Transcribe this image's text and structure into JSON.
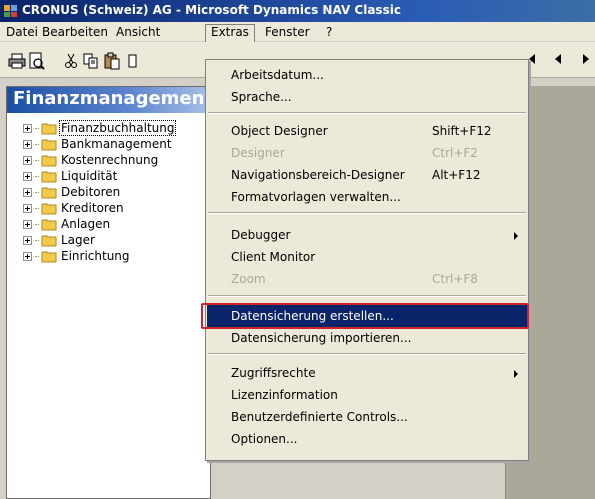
{
  "window": {
    "title": "CRONUS (Schweiz) AG - Microsoft Dynamics NAV Classic"
  },
  "menubar": {
    "items": [
      "Datei",
      "Bearbeiten",
      "Ansicht",
      "Extras",
      "Fenster",
      "?"
    ]
  },
  "toolbar": {
    "icons": [
      "print-icon",
      "print-preview-icon",
      "cut-icon",
      "copy-icon",
      "paste-icon"
    ],
    "nav_icons": [
      "previous-record-icon",
      "next-record-icon"
    ]
  },
  "navpane": {
    "header": "Finanzmanagement",
    "tree": [
      {
        "label": "Finanzbuchhaltung",
        "selected": true
      },
      {
        "label": "Bankmanagement"
      },
      {
        "label": "Kostenrechnung"
      },
      {
        "label": "Liquidität"
      },
      {
        "label": "Debitoren"
      },
      {
        "label": "Kreditoren"
      },
      {
        "label": "Anlagen"
      },
      {
        "label": "Lager"
      },
      {
        "label": "Einrichtung"
      }
    ]
  },
  "extras_menu": {
    "items": [
      {
        "label": "Arbeitsdatum..."
      },
      {
        "label": "Sprache..."
      },
      {
        "label": "Object Designer",
        "shortcut": "Shift+F12"
      },
      {
        "label": "Designer",
        "shortcut": "Ctrl+F2",
        "disabled": true
      },
      {
        "label": "Navigationsbereich-Designer",
        "shortcut": "Alt+F12"
      },
      {
        "label": "Formatvorlagen verwalten..."
      },
      {
        "label": "Debugger",
        "submenu": true
      },
      {
        "label": "Client Monitor"
      },
      {
        "label": "Zoom",
        "shortcut": "Ctrl+F8",
        "disabled": true
      },
      {
        "label": "Datensicherung erstellen...",
        "highlighted": true
      },
      {
        "label": "Datensicherung importieren..."
      },
      {
        "label": "Zugriffsrechte",
        "submenu": true
      },
      {
        "label": "Lizenzinformation"
      },
      {
        "label": "Benutzerdefinierte Controls..."
      },
      {
        "label": "Optionen..."
      }
    ]
  },
  "colors": {
    "titlebar": "#0a246a",
    "menu_highlight": "#0a246a",
    "annotation_box": "#d42027",
    "folder": "#f2c94c"
  }
}
